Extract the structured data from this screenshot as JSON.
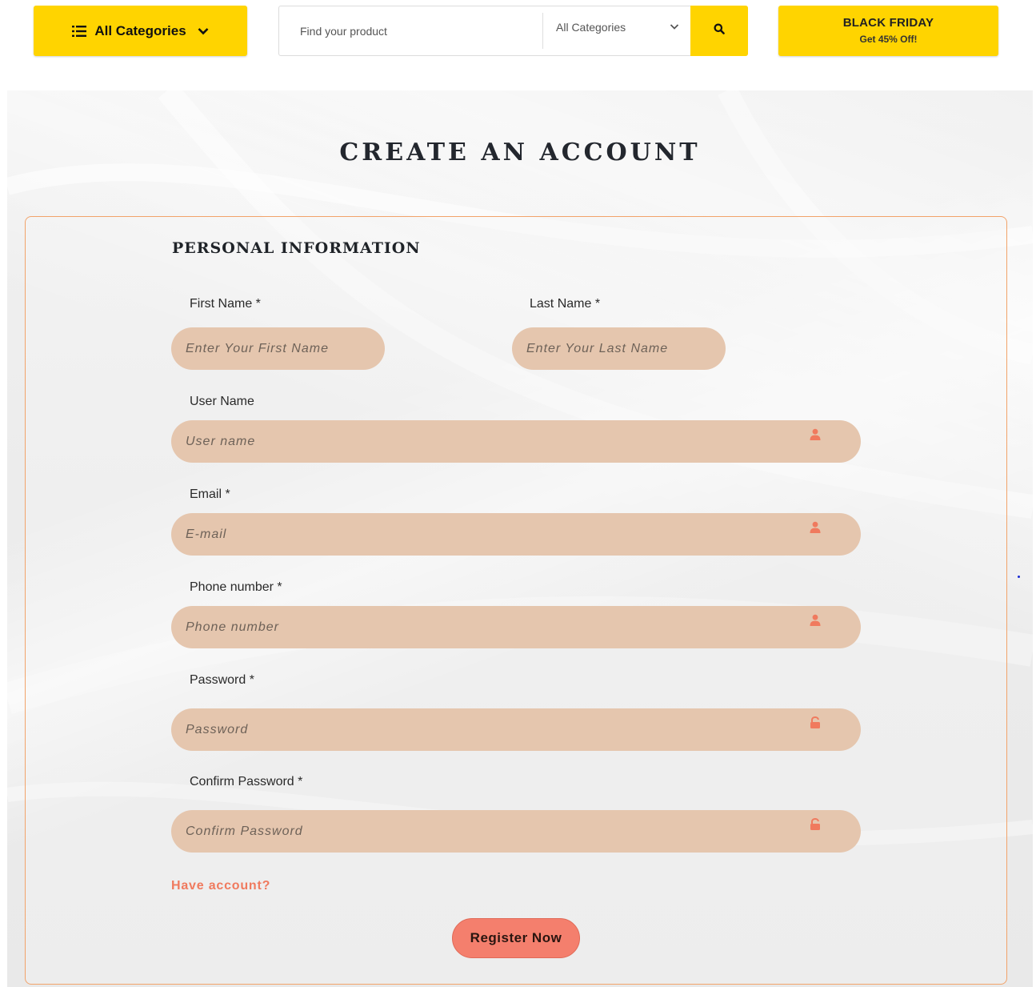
{
  "header": {
    "categories_button_label": "All Categories",
    "search": {
      "placeholder": "Find your product",
      "category_select_value": "All Categories"
    },
    "promo": {
      "title": "BLACK FRIDAY",
      "subtitle": "Get 45% Off!"
    }
  },
  "page": {
    "title": "CREATE AN ACCOUNT",
    "section_heading": "PERSONAL INFORMATION"
  },
  "form": {
    "first_name": {
      "label": "First Name *",
      "placeholder": "Enter Your First Name"
    },
    "last_name": {
      "label": "Last Name *",
      "placeholder": "Enter Your Last Name"
    },
    "user_name": {
      "label": "User Name",
      "placeholder": "User name",
      "icon": "user-icon"
    },
    "email": {
      "label": "Email *",
      "placeholder": "E-mail",
      "icon": "user-icon"
    },
    "phone": {
      "label": "Phone number *",
      "placeholder": "Phone number",
      "icon": "user-icon"
    },
    "password": {
      "label": "Password *",
      "placeholder": "Password",
      "icon": "unlock-icon"
    },
    "confirm_password": {
      "label": "Confirm Password *",
      "placeholder": "Confirm Password",
      "icon": "unlock-icon"
    },
    "have_account_link": "Have account?",
    "register_button": "Register Now"
  },
  "colors": {
    "accent_yellow": "#ffd400",
    "field_bg": "#e5c6ae",
    "link_coral": "#f07a5e",
    "button_coral": "#f47f6d",
    "card_border": "#f2a36a",
    "icon_coral": "#f07a5e"
  }
}
